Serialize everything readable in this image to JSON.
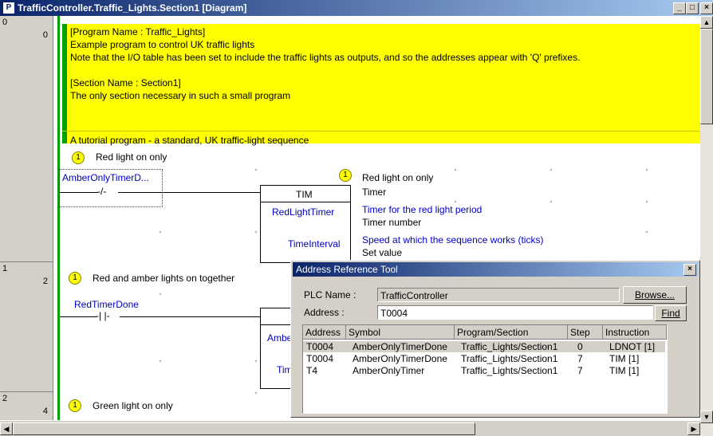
{
  "window": {
    "title": "TrafficController.Traffic_Lights.Section1 [Diagram]",
    "app_icon": "program-icon",
    "minimize": "_",
    "maximize": "□",
    "close": "×"
  },
  "gutter": {
    "rungs": [
      {
        "rung": "0",
        "step": "0"
      },
      {
        "rung": "1",
        "step": "2"
      },
      {
        "rung": "2",
        "step": "4"
      }
    ]
  },
  "comment": {
    "lines": [
      "[Program Name : Traffic_Lights]",
      "Example program to control UK traffic lights",
      "Note that the I/O table has been set to include the traffic lights as outputs, and so the addresses appear with 'Q' prefixes.",
      "[Section Name : Section1]",
      "The only section necessary in such a small program",
      "A tutorial program - a standard, UK traffic-light sequence"
    ]
  },
  "rung0": {
    "num": "1",
    "comment": "Red light on only",
    "contact_label": "AmberOnlyTimerD...",
    "fb_name": "TIM",
    "fb_op1": "RedLightTimer",
    "fb_op2": "TimeInterval",
    "out_num": "1",
    "out_comment": "Red light on only",
    "out_title": "Timer",
    "op1_comment": "Timer for the red light period",
    "op1_desc": "Timer number",
    "op2_comment": "Speed at which the sequence works (ticks)",
    "op2_desc": "Set value"
  },
  "rung1": {
    "num": "1",
    "comment": "Red and amber lights on together",
    "contact_label": "RedTimerDone",
    "fb_op1_partial": "Ambe",
    "fb_op2_partial": "Tim"
  },
  "rung2": {
    "num": "1",
    "comment": "Green light on only"
  },
  "dialog": {
    "title": "Address Reference Tool",
    "plc_label": "PLC Name :",
    "plc_value": "TrafficController",
    "browse": "Browse...",
    "address_label": "Address :",
    "address_value": "T0004",
    "find": "Find",
    "columns": [
      "Address",
      "Symbol",
      "Program/Section",
      "Step",
      "Instruction"
    ],
    "rows": [
      [
        "T0004",
        "AmberOnlyTimerDone",
        "Traffic_Lights/Section1",
        "0",
        "LDNOT [1]"
      ],
      [
        "T0004",
        "AmberOnlyTimerDone",
        "Traffic_Lights/Section1",
        "7",
        "TIM [1]"
      ],
      [
        "T4",
        "AmberOnlyTimer",
        "Traffic_Lights/Section1",
        "7",
        "TIM [1]"
      ]
    ]
  }
}
